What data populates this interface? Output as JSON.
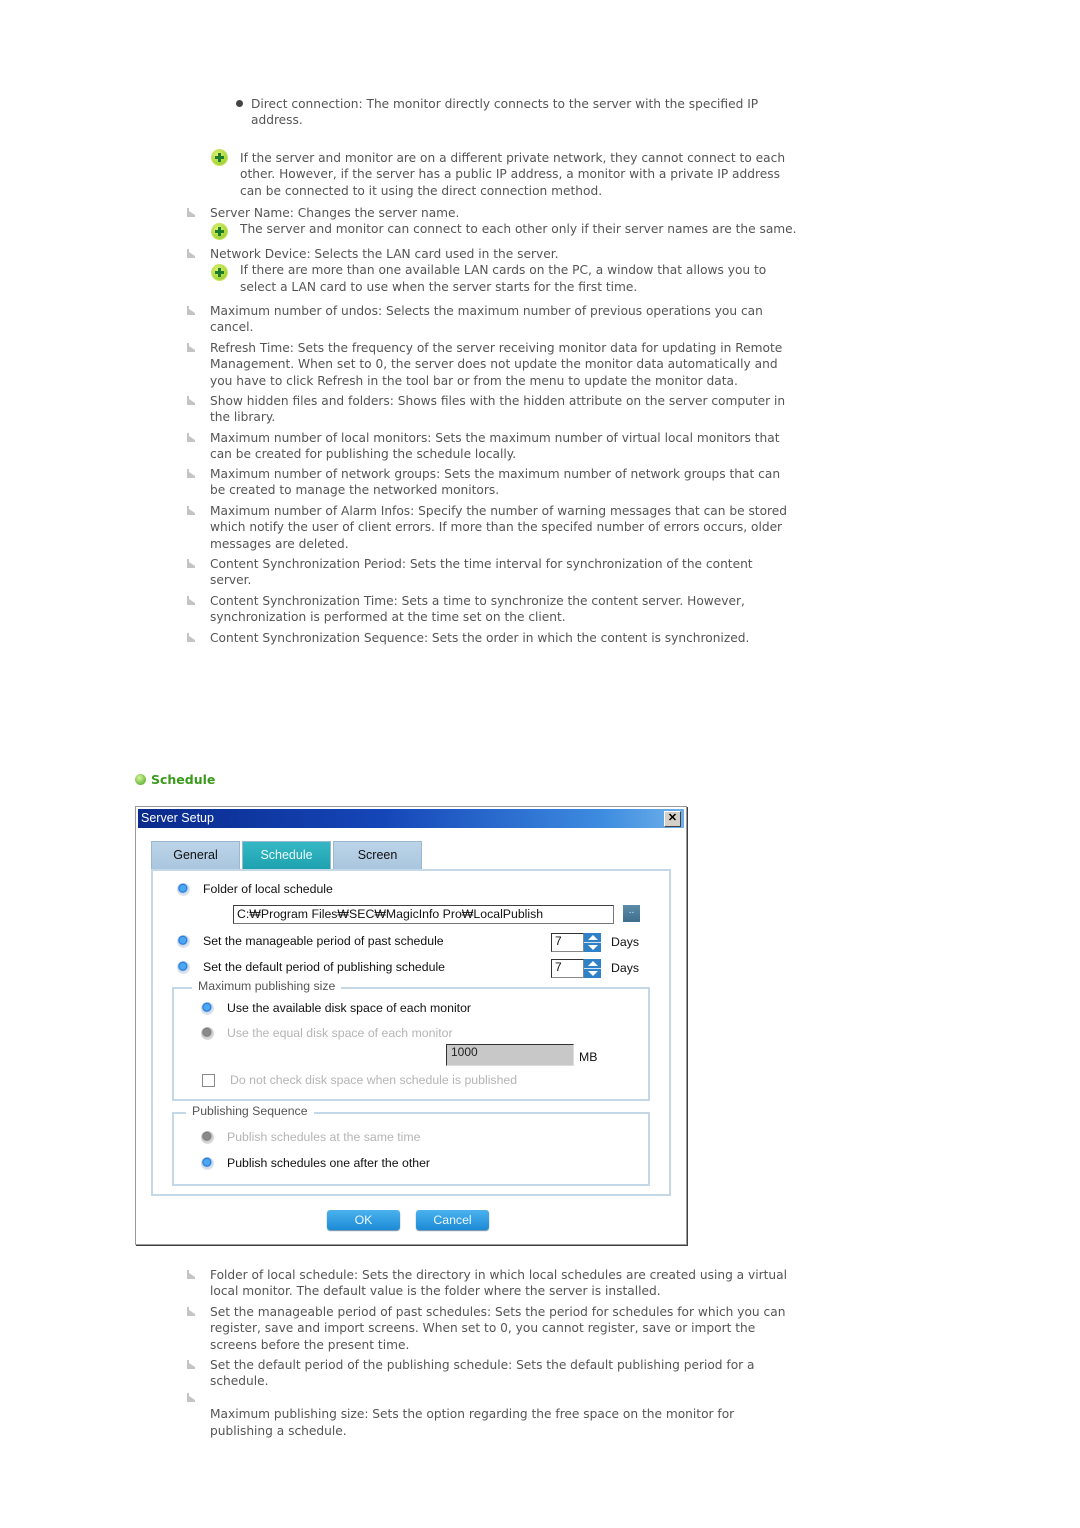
{
  "top_section": {
    "sub_bullet": {
      "lines": [
        "Direct connection: The monitor directly connects to the server with the specified IP",
        "address."
      ]
    },
    "note_1": {
      "icon": "green-plus-icon",
      "lines": [
        "If the server and monitor are on a different private network, they cannot connect to each",
        "other. However, if the server has a public IP address, a monitor with a private IP address",
        "can be connected to it using the direct connection method."
      ]
    },
    "items": [
      {
        "lines": [
          "Server Name: Changes the server name."
        ],
        "note": [
          "The server and monitor can connect to each other only if their server names are the same."
        ]
      },
      {
        "lines": [
          "Network Device: Selects the LAN card used in the server."
        ],
        "note": [
          "If there are more than one available LAN cards on the PC, a window that allows you to",
          "select a LAN card to use when the server starts for the first time."
        ]
      },
      {
        "lines": [
          "Maximum number of undos: Selects the maximum number of previous operations you can",
          "cancel."
        ]
      },
      {
        "lines": [
          "Refresh Time: Sets the frequency of the server receiving monitor data for updating in Remote",
          "Management. When set to 0, the server does not update the monitor data automatically and",
          "you have to click Refresh in the tool bar or from the menu to update the monitor data."
        ]
      },
      {
        "lines": [
          "Show hidden files and folders: Shows files with the hidden attribute on the server computer in",
          "the library."
        ]
      },
      {
        "lines": [
          "Maximum number of local monitors: Sets the maximum number of virtual local monitors that",
          "can be created for publishing the schedule locally."
        ]
      },
      {
        "lines": [
          "Maximum number of network groups: Sets the maximum number of network groups that can",
          "be created to manage the networked monitors."
        ]
      },
      {
        "lines": [
          "Maximum number of Alarm Infos: Specify the number of warning messages that can be stored",
          "which notify the user of client errors. If more than the specifed number of errors occurs, older",
          "messages are deleted."
        ]
      },
      {
        "lines": [
          "Content Synchronization Period: Sets the time interval for synchronization of the content",
          "server."
        ]
      },
      {
        "lines": [
          "Content Synchronization Time: Sets a time to synchronize the content server. However,",
          "synchronization is performed at the time set on the client."
        ]
      },
      {
        "lines": [
          "Content Synchronization Sequence: Sets the order in which the content is synchronized."
        ]
      }
    ]
  },
  "section_heading": "Schedule",
  "dialog": {
    "title": "Server Setup",
    "close_label": "✕",
    "tabs": [
      {
        "label": "General",
        "active": false
      },
      {
        "label": "Schedule",
        "active": true
      },
      {
        "label": "Screen",
        "active": false
      }
    ],
    "folder_label": "Folder of local schedule",
    "folder_path": "C:\\Program Files\\SEC\\MagicInfo Pro\\LocalPublish",
    "folder_path_display": "C:₩Program Files₩SEC₩MagicInfo Pro₩LocalPublish",
    "browse_label": "..",
    "past_period_label": "Set the manageable period of past schedule",
    "past_period_value": "7",
    "default_period_label": "Set the default period of publishing schedule",
    "default_period_value": "7",
    "days_unit": "Days",
    "max_size_group": {
      "label": "Maximum publishing size",
      "option_available": "Use the available disk space of each monitor",
      "option_equal": "Use the equal disk space of each monitor",
      "size_value": "1000",
      "size_unit": "MB",
      "no_check_label": "Do not check disk space when schedule is published",
      "no_check_checked": false
    },
    "sequence_group": {
      "label": "Publishing Sequence",
      "option_same_time": "Publish schedules at the same time",
      "option_one_after": "Publish schedules one after the other"
    },
    "ok_label": "OK",
    "cancel_label": "Cancel"
  },
  "bottom_section": {
    "items": [
      {
        "lines": [
          "Folder of local schedule: Sets the directory in which local schedules are created using a virtual",
          "local monitor. The default value is the folder where the server is installed."
        ]
      },
      {
        "lines": [
          "Set the manageable period of past schedules: Sets the period for schedules for which you can",
          "register, save and import screens. When set to 0, you cannot register, save or import the",
          "screens before the present time."
        ]
      },
      {
        "lines": [
          "Set the default period of the publishing schedule: Sets the default publishing period for a",
          "schedule."
        ]
      },
      {
        "lines": [
          "",
          "Maximum publishing size: Sets the option regarding the free space on the monitor for",
          "publishing a schedule."
        ]
      }
    ]
  }
}
